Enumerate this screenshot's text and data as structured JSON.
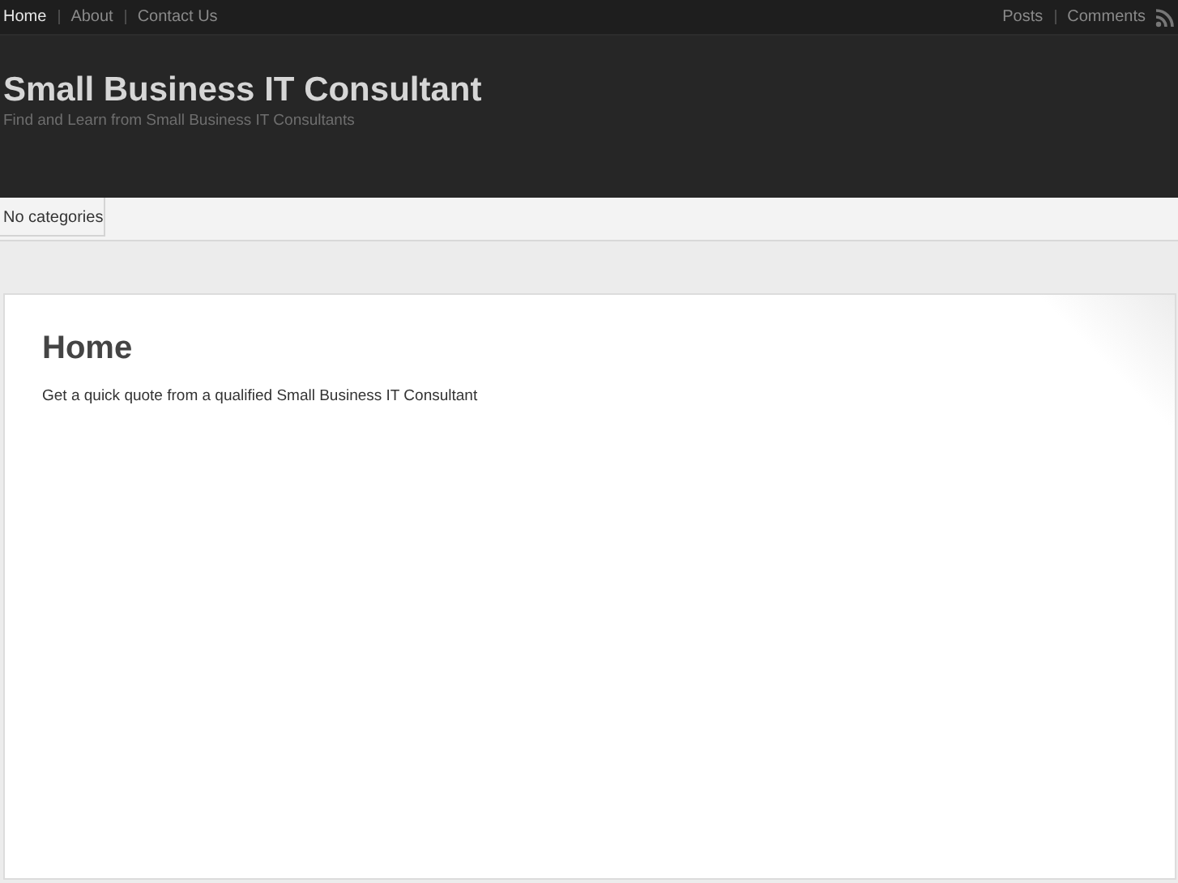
{
  "top_nav": {
    "left": [
      {
        "label": "Home",
        "selected": true
      },
      {
        "label": "About",
        "selected": false
      },
      {
        "label": "Contact Us",
        "selected": false
      }
    ],
    "right": [
      {
        "label": "Posts"
      },
      {
        "label": "Comments"
      }
    ]
  },
  "header": {
    "title": "Small Business IT Consultant",
    "tagline": "Find and Learn from Small Business IT Consultants"
  },
  "category_bar": {
    "items": [
      "No categories"
    ]
  },
  "content": {
    "heading": "Home",
    "text": "Get a quick quote from a qualified Small Business IT Consultant"
  }
}
